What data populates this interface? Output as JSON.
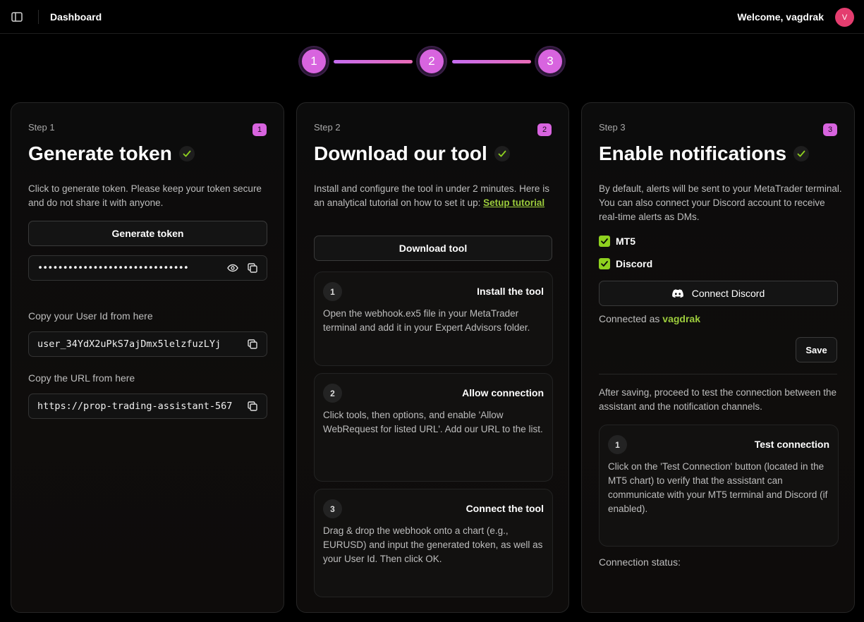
{
  "header": {
    "title": "Dashboard",
    "welcome": "Welcome, vagdrak",
    "avatar_initial": "V"
  },
  "stepper": [
    "1",
    "2",
    "3"
  ],
  "card1": {
    "step_label": "Step 1",
    "badge": "1",
    "title": "Generate token",
    "description": "Click to generate token. Please keep your token secure and do not share it with anyone.",
    "generate_button": "Generate token",
    "token_masked": "••••••••••••••••••••••••••••••",
    "user_id_label": "Copy your User Id from here",
    "user_id_value": "user_34YdX2uPkS7ajDmx5lelzfuzLYj",
    "url_label": "Copy the URL from here",
    "url_value": "https://prop-trading-assistant-567"
  },
  "card2": {
    "step_label": "Step 2",
    "badge": "2",
    "title": "Download our tool",
    "description": "Install and configure the tool in under 2 minutes. Here is an analytical tutorial on how to set it up:",
    "tutorial_link": "Setup tutorial",
    "download_button": "Download tool",
    "substeps": [
      {
        "num": "1",
        "title": "Install the tool",
        "desc": "Open the webhook.ex5 file in your MetaTrader terminal and add it in your Expert Advisors folder."
      },
      {
        "num": "2",
        "title": "Allow connection",
        "desc": "Click tools, then options, and enable 'Allow WebRequest for listed URL'. Add our URL to the list."
      },
      {
        "num": "3",
        "title": "Connect the tool",
        "desc": "Drag & drop the webhook onto a chart (e.g., EURUSD) and input the generated token, as well as your User Id. Then click OK."
      }
    ]
  },
  "card3": {
    "step_label": "Step 3",
    "badge": "3",
    "title": "Enable notifications",
    "description": "By default, alerts will be sent to your MetaTrader terminal. You can also connect your Discord account to receive real-time alerts as DMs.",
    "mt5_label": "MT5",
    "discord_label": "Discord",
    "connect_button": "Connect Discord",
    "connected_prefix": "Connected as",
    "connected_user": "vagdrak",
    "save_button": "Save",
    "after_saving": "After saving, proceed to test the connection between the assistant and the notification channels.",
    "test_step": {
      "num": "1",
      "title": "Test connection",
      "desc": "Click on the 'Test Connection' button (located in the MT5 chart) to verify that the assistant can communicate with your MT5 terminal and Discord (if enabled)."
    },
    "connection_status": "Connection status:"
  },
  "colors": {
    "accent": "#d864df",
    "check": "#8fd11f",
    "link": "#9ccc3c"
  }
}
